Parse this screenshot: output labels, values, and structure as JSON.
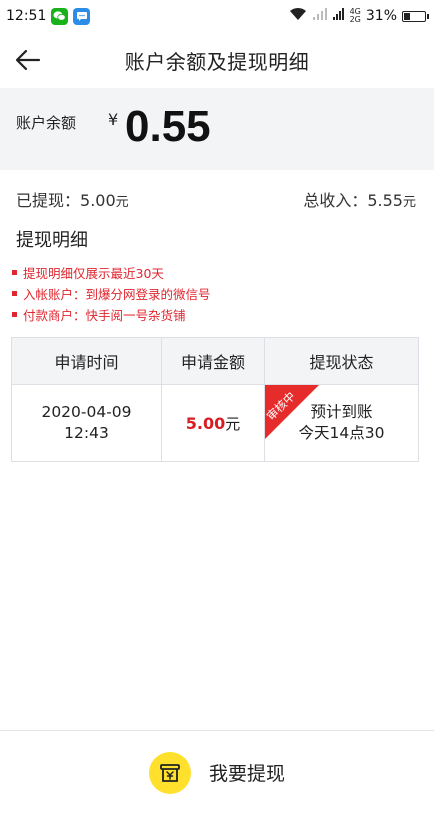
{
  "status_bar": {
    "time": "12:51",
    "signal_text_top": "4G",
    "signal_text_bottom": "2G",
    "battery": "31%",
    "battery_level_percent": 31
  },
  "header": {
    "title": "账户余额及提现明细"
  },
  "balance": {
    "label": "账户余额",
    "currency": "¥",
    "amount": "0.55"
  },
  "stats": {
    "withdrawn_label": "已提现：",
    "withdrawn_value": "5.00",
    "total_income_label": "总收入：",
    "total_income_value": "5.55",
    "unit": "元"
  },
  "details": {
    "title": "提现明细",
    "notes": [
      "提现明细仅展示最近30天",
      "入帐账户：到爆分网登录的微信号",
      "付款商户：快手阅一号杂货铺"
    ]
  },
  "table": {
    "headers": [
      "申请时间",
      "申请金额",
      "提现状态"
    ],
    "rows": [
      {
        "date": "2020-04-09",
        "time": "12:43",
        "amount": "5.00",
        "amount_unit": "元",
        "ribbon": "审核中",
        "status_line1": "预计到账",
        "status_line2": "今天14点30"
      }
    ]
  },
  "bottom": {
    "withdraw_label": "我要提现"
  },
  "colors": {
    "accent_red": "#d81e23",
    "button_yellow": "#ffe12d",
    "card_gray": "#f2f4f6"
  }
}
